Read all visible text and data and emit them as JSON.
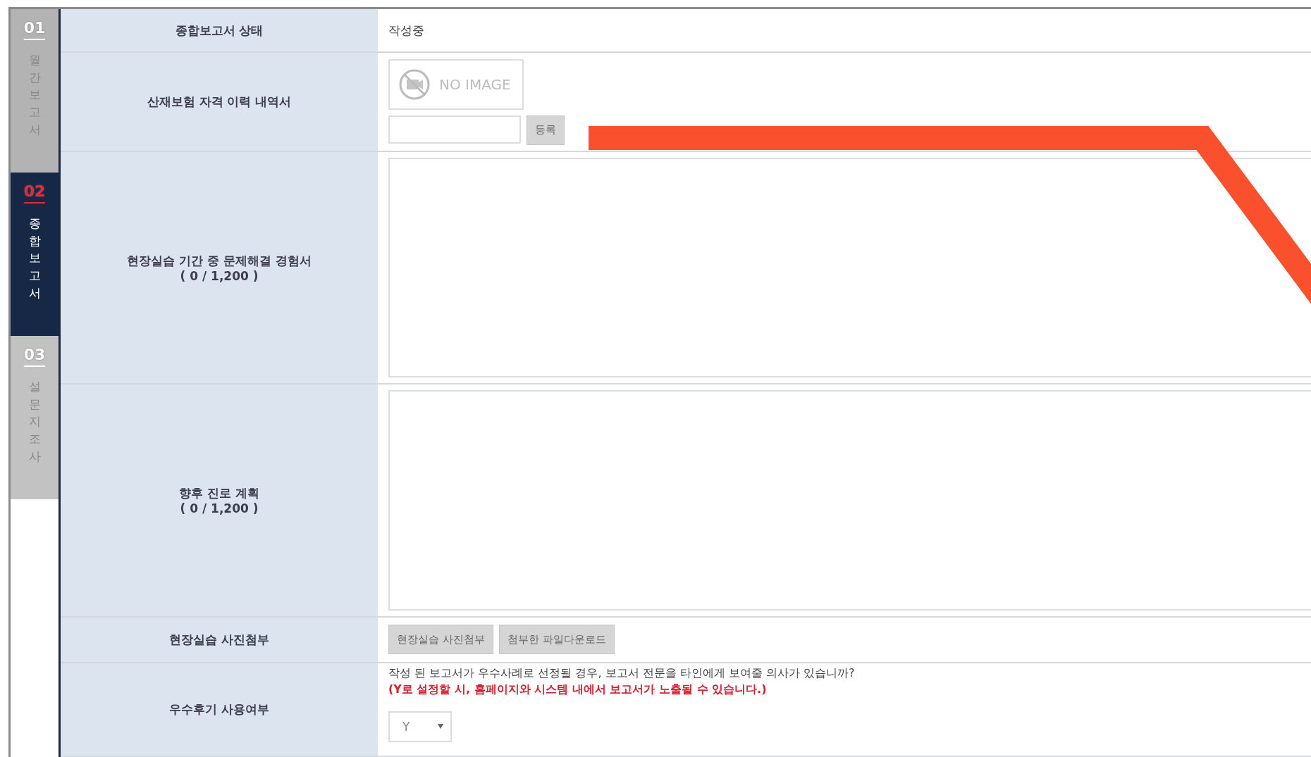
{
  "sidebar": {
    "items": [
      {
        "number": "01",
        "label": "월간보고서",
        "selected": false
      },
      {
        "number": "02",
        "label": "종합보고서",
        "selected": true
      },
      {
        "number": "03",
        "label": "설문지조사",
        "selected": false
      }
    ]
  },
  "form": {
    "rows": [
      {
        "kind": "status",
        "label": "종합보고서 상태",
        "value": "작성중"
      },
      {
        "kind": "file",
        "label": "산재보험 자격 이력 내역서",
        "image_text": "NO IMAGE",
        "button": "등록"
      },
      {
        "kind": "textarea",
        "label": "현장실습 기간 중 문제해결 경험서",
        "counter": "( 0 / 1,200 )"
      },
      {
        "kind": "textarea",
        "label": "향후 진로 계획",
        "counter": "( 0 / 1,200 )"
      },
      {
        "kind": "buttons",
        "label": "현장실습 사진첨부",
        "buttons": [
          "현장실습 사진첨부",
          "첨부한 파일다운로드"
        ]
      },
      {
        "kind": "select",
        "label": "우수후기 사용여부",
        "question": "작성 된 보고서가 우수사례로 선정될 경우, 보고서 전문을 타인에게 보여줄 의사가 있습니까?",
        "warning": "(Y로 설정할 시, 홈페이지와 시스템 내에서 보고서가 노출될 수 있습니다.)",
        "value": "Y"
      }
    ]
  }
}
